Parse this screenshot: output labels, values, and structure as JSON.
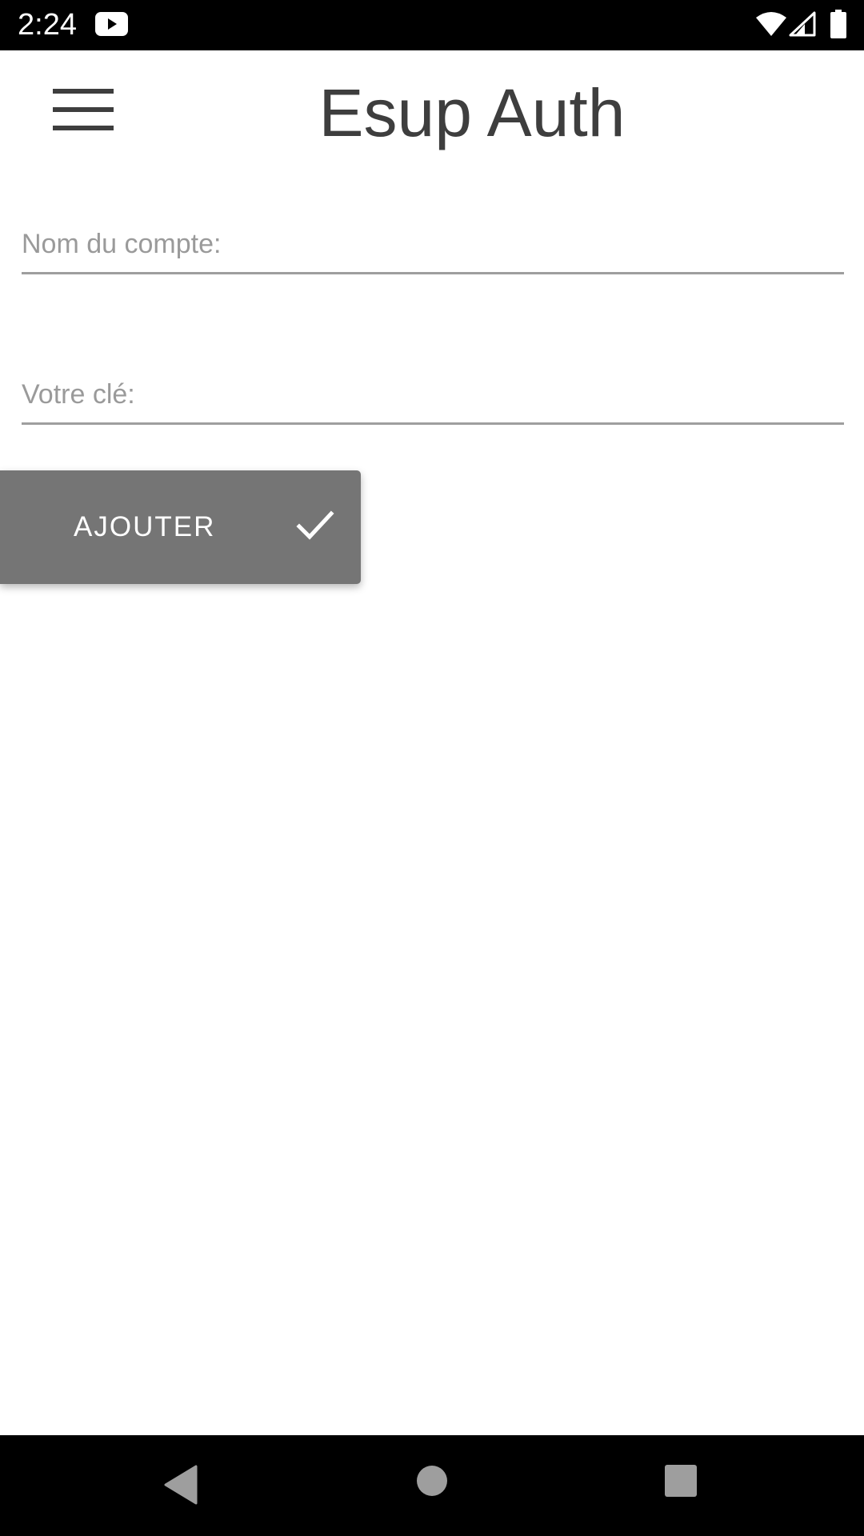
{
  "status_bar": {
    "time": "2:24",
    "icons": [
      "youtube-icon",
      "wifi-icon",
      "signal-icon",
      "battery-icon"
    ]
  },
  "header": {
    "title": "Esup Auth",
    "menu_icon": "hamburger-menu-icon"
  },
  "form": {
    "account_name": {
      "placeholder": "Nom du compte:",
      "value": ""
    },
    "secret_key": {
      "placeholder": "Votre clé:",
      "value": ""
    },
    "add_button": {
      "label": "AJOUTER",
      "icon": "check-icon"
    }
  },
  "nav_bar": {
    "buttons": [
      "back",
      "home",
      "recents"
    ]
  },
  "colors": {
    "status_bar_bg": "#000000",
    "title_text": "#3e3e3e",
    "placeholder_text": "#9a9a9a",
    "field_underline": "#9e9e9e",
    "button_bg": "#757575",
    "button_text": "#ffffff",
    "nav_bar_bg": "#000000",
    "nav_icon": "#9e9e9e"
  }
}
